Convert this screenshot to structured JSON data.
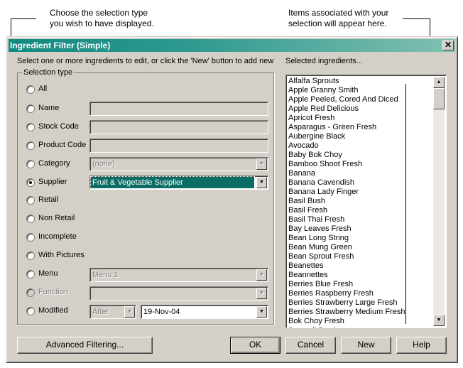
{
  "annotations": {
    "left": [
      "Choose the selection type",
      "you wish to have displayed."
    ],
    "right": [
      "Items associated with your",
      "selection will appear here."
    ]
  },
  "dialog": {
    "title": "Ingredient Filter (Simple)",
    "close_icon": "close-icon",
    "instruction": "Select one or more ingredients to edit, or click the 'New' button to add new",
    "selected_label": "Selected ingredients...",
    "group_label": "Selection type",
    "options": [
      {
        "label": "All",
        "selected": false
      },
      {
        "label": "Name",
        "selected": false
      },
      {
        "label": "Stock Code",
        "selected": false
      },
      {
        "label": "Product Code",
        "selected": false
      },
      {
        "label": "Category",
        "selected": false
      },
      {
        "label": "Supplier",
        "selected": true
      },
      {
        "label": "Retail",
        "selected": false
      },
      {
        "label": "Non Retail",
        "selected": false
      },
      {
        "label": "Incomplete",
        "selected": false
      },
      {
        "label": "With Pictures",
        "selected": false
      },
      {
        "label": "Menu",
        "selected": false
      },
      {
        "label": "Function",
        "selected": false,
        "disabled": true
      },
      {
        "label": "Modified",
        "selected": false
      }
    ],
    "fields": {
      "name": "",
      "stock_code": "",
      "product_code": "",
      "category": "(none)",
      "supplier": "Fruit & Vegetable Supplier",
      "menu": "Menu 1",
      "function": "",
      "modified_op": "After",
      "modified_date": "19-Nov-04"
    },
    "ingredients": [
      "Alfalfa Sprouts",
      "Apple Granny Smith",
      "Apple Peeled, Cored And Diced",
      "Apple Red Delicious",
      "Apricot Fresh",
      "Asparagus - Green Fresh",
      "Aubergine Black",
      "Avocado",
      "Baby Bok Choy",
      "Bamboo Shoot Fresh",
      "Banana",
      "Banana Cavendish",
      "Banana Lady Finger",
      "Basil Bush",
      "Basil Fresh",
      "Basil Thai Fresh",
      "Bay Leaves Fresh",
      "Bean Long String",
      "Bean Mung Green",
      "Bean Sprout Fresh",
      "Beanettes",
      "Beannettes",
      "Berries Blue Fresh",
      "Berries Raspberry Fresh",
      "Berries Strawberry Large Fresh",
      "Berries Strawberry Medium Fresh",
      "Bok Choy Fresh",
      "Broccoli Fresh"
    ],
    "buttons": {
      "advanced": "Advanced Filtering...",
      "ok": "OK",
      "cancel": "Cancel",
      "new": "New",
      "help": "Help"
    },
    "colors": {
      "title_start": "#138a80",
      "title_end": "#82c0b0",
      "face": "#d4d0c8",
      "selection": "#0a6e64"
    }
  }
}
